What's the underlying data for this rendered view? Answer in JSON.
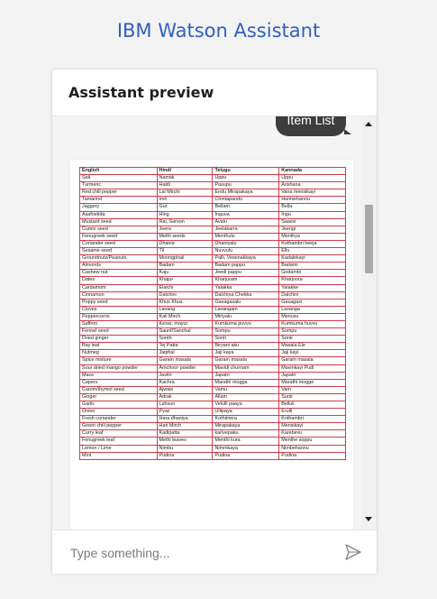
{
  "page": {
    "header_cut_text": "",
    "title": "IBM Watson Assistant"
  },
  "preview": {
    "title": "Assistant preview",
    "message_bubble": "Item List",
    "input_placeholder": "Type something..."
  },
  "table": {
    "headers": [
      "English",
      "Hindi",
      "Telugu",
      "Kannada"
    ],
    "rows": [
      [
        "Salt",
        "Namak",
        "Uppu",
        "Uppu"
      ],
      [
        "Turmeric",
        "Haldi",
        "Pasupu",
        "Arishana"
      ],
      [
        "Red chili pepper",
        "Lal Mirchi",
        "Endu Mirapakaya",
        "Vana mensikayi"
      ],
      [
        "Tamarind",
        "Imli",
        "Chintapandu",
        "Hunisehannu"
      ],
      [
        "Jaggery",
        "Gur",
        "Bellam",
        "Bella"
      ],
      [
        "Asafoetida",
        "Hing",
        "Inguva",
        "Ingu"
      ],
      [
        "Mustard seed",
        "Rai, Sarson",
        "Avalu",
        "Saasvi"
      ],
      [
        "Cumin seed",
        "Jeera",
        "Jeelakarra",
        "Jeerigi"
      ],
      [
        "Fenugreek seed",
        "Methi seeds",
        "Menthulu",
        "Menthya"
      ],
      [
        "Coriander seed",
        "Dhania",
        "Dhaniyalu",
        "Kothambri beeja"
      ],
      [
        "Sesame seed",
        "Til",
        "Nuvvulu",
        "Ellu"
      ],
      [
        "Groundnuts/Peanuts",
        "Moongphali",
        "Palli, Vesenakkaya",
        "Kadalekayi"
      ],
      [
        "Almonds",
        "Badam",
        "Badam pappu",
        "Badami"
      ],
      [
        "Cashew nut",
        "Kaju",
        "Jeedi pappu",
        "Godambi"
      ],
      [
        "Dates",
        "Khajur",
        "Kharjuram",
        "Kharjoora"
      ],
      [
        "Cardamom",
        "Elaichi",
        "Yalakka",
        "Yalakke"
      ],
      [
        "Cinnamon",
        "Dalchini",
        "Dalchina Chekka",
        "Dalchini"
      ],
      [
        "Poppy seed",
        "Khus Khus",
        "Gasagasalu",
        "Gasagasi"
      ],
      [
        "Cloves",
        "Lavang",
        "Lavangam",
        "Lavanga"
      ],
      [
        "Peppercorns",
        "Kali Mirch",
        "Miriyalu",
        "Menusu"
      ],
      [
        "Saffron",
        "Kesar, mayur",
        "Kumkuma puvvu",
        "Kumkuma huvvu"
      ],
      [
        "Fennel seed",
        "Saunf/Sanchal",
        "Sompu",
        "Sompu"
      ],
      [
        "Dried ginger",
        "Sonth",
        "Sonti",
        "Sonti"
      ],
      [
        "Bay leaf",
        "Tej Patta",
        "Biryani aku",
        "Masala Ele"
      ],
      [
        "Nutmeg",
        "Jaiphal",
        "Jaji kaya",
        "Jaji kayi"
      ],
      [
        "Spice mixture",
        "Garam masala",
        "Garam masala",
        "Garam masala"
      ],
      [
        "Sour dried mango powder",
        "Amchoor powder",
        "Mavidi churnam",
        "Mavinkayi Pudi"
      ],
      [
        "Mace",
        "Javitri",
        "Japatri",
        "Japatri"
      ],
      [
        "Capers",
        "Kachra",
        "Marathi mogga",
        "Marathi mogge"
      ],
      [
        "Carom/thymol seed",
        "Ajwain",
        "Vamu",
        "Vam"
      ],
      [
        "Ginger",
        "Adrak",
        "Allam",
        "Sunti"
      ],
      [
        "Garlic",
        "Lahsun",
        "Velulli paaya",
        "Belluli"
      ],
      [
        "Onion",
        "Pyaz",
        "Ullipaya",
        "Erulli"
      ],
      [
        "Fresh coriander",
        "Hara dhaniya",
        "Kothimera",
        "Kothambri"
      ],
      [
        "Green chili pepper",
        "Hari Mirch",
        "Mirapakaya",
        "Mensikayi"
      ],
      [
        "Curry leaf",
        "Kadipatta",
        "karivepaku",
        "Karebevu"
      ],
      [
        "Fenugreek leaf",
        "Methi leaves",
        "Menthi kura",
        "Menthe soppu"
      ],
      [
        "Lemon / Lime",
        "Nimbu",
        "Nimmkaya",
        "Nimbehannu"
      ],
      [
        "Mint",
        "Pudina",
        "Pudina",
        "Pudina"
      ]
    ]
  },
  "icons": {
    "send": "send-icon",
    "scroll_up": "scroll-up-icon",
    "scroll_down": "scroll-down-icon"
  },
  "colors": {
    "title_blue": "#2f5fc4",
    "table_border": "#d23b4a",
    "bubble": "#3d3d3d"
  }
}
